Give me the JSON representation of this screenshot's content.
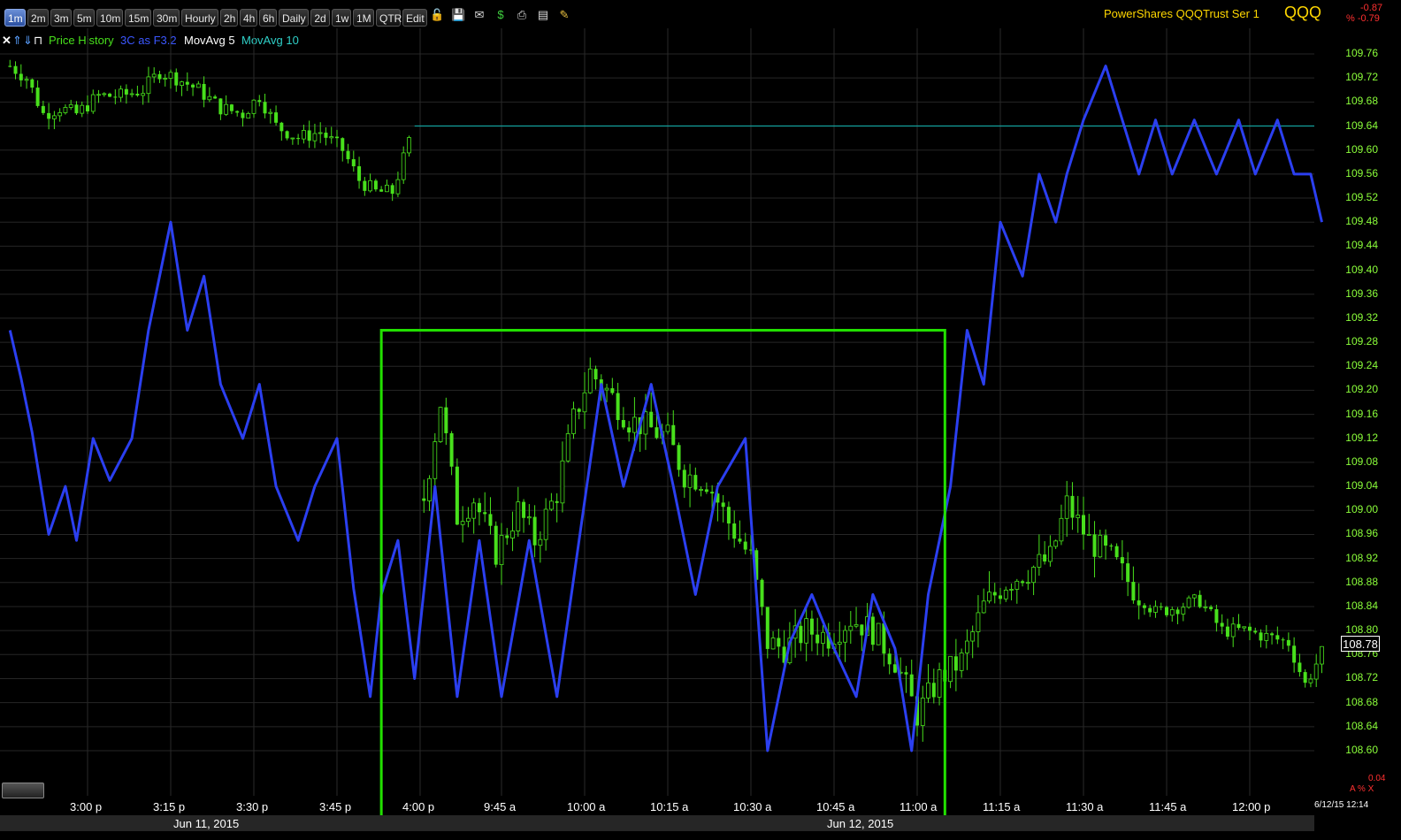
{
  "toolbar": {
    "timeframes": [
      "1m",
      "2m",
      "3m",
      "5m",
      "10m",
      "15m",
      "30m",
      "Hourly",
      "2h",
      "4h",
      "6h",
      "Daily",
      "2d",
      "1w",
      "1M",
      "QTR",
      "Edit"
    ],
    "active": "1m",
    "icons": [
      "lock-icon",
      "save-icon",
      "mail-icon",
      "dollar-icon",
      "print-icon",
      "card-icon",
      "pencil-icon"
    ]
  },
  "symbol": {
    "name": "PowerShares QQQTrust Ser 1",
    "ticker": "QQQ",
    "change": "-0.87",
    "change_pct": "% -0.79"
  },
  "legend": {
    "price_history": "Price History",
    "indicator": "3C as F3.2",
    "ma5": "MovAvg 5",
    "ma10": "MovAvg 10"
  },
  "colors": {
    "price": "#48e01c",
    "indicator": "#2b3ff0",
    "highlight_box": "#22e000",
    "ma10": "#14a09c",
    "axis_text": "#8bff3a"
  },
  "current_price": "108.78",
  "timestamp": "6/12/15 12:14",
  "bottom_right": {
    "value": "0.04",
    "label": "A % X"
  },
  "dates": [
    "Jun 11, 2015",
    "Jun 12, 2015"
  ],
  "chart_data": {
    "type": "candlestick",
    "title": "",
    "y_axis_ticks": [
      "109.76",
      "109.72",
      "109.68",
      "109.64",
      "109.60",
      "109.56",
      "109.52",
      "109.48",
      "109.44",
      "109.40",
      "109.36",
      "109.32",
      "109.28",
      "109.24",
      "109.20",
      "109.16",
      "109.12",
      "109.08",
      "109.04",
      "109.00",
      "108.96",
      "108.92",
      "108.88",
      "108.84",
      "108.80",
      "108.76",
      "108.72",
      "108.68",
      "108.64",
      "108.60"
    ],
    "ylim": [
      108.57,
      109.79
    ],
    "x_tick_labels": [
      "3:00 p",
      "3:15 p",
      "3:30 p",
      "3:45 p",
      "4:00 p",
      "9:45 a",
      "10:00 a",
      "10:15 a",
      "10:30 a",
      "10:45 a",
      "11:00 a",
      "11:15 a",
      "11:30 a",
      "11:45 a",
      "12:00 p"
    ],
    "sessions": [
      {
        "date": "Jun 11, 2015",
        "start": "2:46 p",
        "end": "4:00 p"
      },
      {
        "date": "Jun 12, 2015",
        "start": "9:30 a",
        "end": "12:14 p"
      }
    ],
    "price_path": [
      {
        "time": "2:46 p",
        "price": 109.74
      },
      {
        "time": "2:49 p",
        "price": 109.72
      },
      {
        "time": "2:52 p",
        "price": 109.66
      },
      {
        "time": "2:55 p",
        "price": 109.67
      },
      {
        "time": "2:58 p",
        "price": 109.66
      },
      {
        "time": "3:02 p",
        "price": 109.69
      },
      {
        "time": "3:06 p",
        "price": 109.69
      },
      {
        "time": "3:10 p",
        "price": 109.7
      },
      {
        "time": "3:13 p",
        "price": 109.73
      },
      {
        "time": "3:16 p",
        "price": 109.72
      },
      {
        "time": "3:20 p",
        "price": 109.7
      },
      {
        "time": "3:24 p",
        "price": 109.67
      },
      {
        "time": "3:28 p",
        "price": 109.66
      },
      {
        "time": "3:31 p",
        "price": 109.69
      },
      {
        "time": "3:34 p",
        "price": 109.64
      },
      {
        "time": "3:38 p",
        "price": 109.62
      },
      {
        "time": "3:42 p",
        "price": 109.63
      },
      {
        "time": "3:46 p",
        "price": 109.6
      },
      {
        "time": "3:49 p",
        "price": 109.55
      },
      {
        "time": "3:52 p",
        "price": 109.53
      },
      {
        "time": "3:55 p",
        "price": 109.53
      },
      {
        "time": "3:59 p",
        "price": 109.64
      },
      {
        "time": "9:31 a",
        "price": 109.02
      },
      {
        "time": "9:34 a",
        "price": 109.18
      },
      {
        "time": "9:37 a",
        "price": 108.99
      },
      {
        "time": "9:40 a",
        "price": 109.02
      },
      {
        "time": "9:44 a",
        "price": 108.93
      },
      {
        "time": "9:48 a",
        "price": 109.0
      },
      {
        "time": "9:51 a",
        "price": 108.95
      },
      {
        "time": "9:55 a",
        "price": 109.03
      },
      {
        "time": "9:58 a",
        "price": 109.15
      },
      {
        "time": "10:01 a",
        "price": 109.23
      },
      {
        "time": "10:04 a",
        "price": 109.2
      },
      {
        "time": "10:08 a",
        "price": 109.15
      },
      {
        "time": "10:11 a",
        "price": 109.14
      },
      {
        "time": "10:15 a",
        "price": 109.12
      },
      {
        "time": "10:18 a",
        "price": 109.06
      },
      {
        "time": "10:22 a",
        "price": 109.05
      },
      {
        "time": "10:26 a",
        "price": 108.98
      },
      {
        "time": "10:30 a",
        "price": 108.92
      },
      {
        "time": "10:33 a",
        "price": 108.78
      },
      {
        "time": "10:36 a",
        "price": 108.77
      },
      {
        "time": "10:40 a",
        "price": 108.8
      },
      {
        "time": "10:44 a",
        "price": 108.79
      },
      {
        "time": "10:48 a",
        "price": 108.82
      },
      {
        "time": "10:52 a",
        "price": 108.8
      },
      {
        "time": "10:56 a",
        "price": 108.75
      },
      {
        "time": "11:00 a",
        "price": 108.66
      },
      {
        "time": "11:04 a",
        "price": 108.72
      },
      {
        "time": "11:08 a",
        "price": 108.75
      },
      {
        "time": "11:12 a",
        "price": 108.84
      },
      {
        "time": "11:16 a",
        "price": 108.88
      },
      {
        "time": "11:20 a",
        "price": 108.9
      },
      {
        "time": "11:24 a",
        "price": 108.92
      },
      {
        "time": "11:27 a",
        "price": 109.01
      },
      {
        "time": "11:31 a",
        "price": 108.95
      },
      {
        "time": "11:35 a",
        "price": 108.92
      },
      {
        "time": "11:39 a",
        "price": 108.87
      },
      {
        "time": "11:43 a",
        "price": 108.83
      },
      {
        "time": "11:47 a",
        "price": 108.84
      },
      {
        "time": "11:51 a",
        "price": 108.85
      },
      {
        "time": "11:55 a",
        "price": 108.8
      },
      {
        "time": "11:59 a",
        "price": 108.8
      },
      {
        "time": "12:03 p",
        "price": 108.79
      },
      {
        "time": "12:07 p",
        "price": 108.78
      },
      {
        "time": "12:10 p",
        "price": 108.71
      },
      {
        "time": "12:14 p",
        "price": 108.78
      }
    ],
    "ma10_level": 109.64,
    "indicator_path": [
      {
        "time": "2:46 p",
        "price": 109.3
      },
      {
        "time": "2:48 p",
        "price": 109.22
      },
      {
        "time": "2:50 p",
        "price": 109.13
      },
      {
        "time": "2:53 p",
        "price": 108.96
      },
      {
        "time": "2:56 p",
        "price": 109.04
      },
      {
        "time": "2:58 p",
        "price": 108.95
      },
      {
        "time": "3:01 p",
        "price": 109.12
      },
      {
        "time": "3:04 p",
        "price": 109.05
      },
      {
        "time": "3:08 p",
        "price": 109.12
      },
      {
        "time": "3:11 p",
        "price": 109.3
      },
      {
        "time": "3:15 p",
        "price": 109.48
      },
      {
        "time": "3:18 p",
        "price": 109.3
      },
      {
        "time": "3:21 p",
        "price": 109.39
      },
      {
        "time": "3:24 p",
        "price": 109.21
      },
      {
        "time": "3:28 p",
        "price": 109.12
      },
      {
        "time": "3:31 p",
        "price": 109.21
      },
      {
        "time": "3:34 p",
        "price": 109.04
      },
      {
        "time": "3:38 p",
        "price": 108.95
      },
      {
        "time": "3:41 p",
        "price": 109.04
      },
      {
        "time": "3:45 p",
        "price": 109.12
      },
      {
        "time": "3:48 p",
        "price": 108.87
      },
      {
        "time": "3:51 p",
        "price": 108.69
      },
      {
        "time": "3:53 p",
        "price": 108.86
      },
      {
        "time": "3:56 p",
        "price": 108.95
      },
      {
        "time": "3:59 p",
        "price": 108.72
      },
      {
        "time": "9:33 a",
        "price": 109.04
      },
      {
        "time": "9:37 a",
        "price": 108.69
      },
      {
        "time": "9:41 a",
        "price": 108.95
      },
      {
        "time": "9:45 a",
        "price": 108.69
      },
      {
        "time": "9:50 a",
        "price": 108.95
      },
      {
        "time": "9:55 a",
        "price": 108.69
      },
      {
        "time": "9:59 a",
        "price": 108.95
      },
      {
        "time": "10:03 a",
        "price": 109.21
      },
      {
        "time": "10:07 a",
        "price": 109.04
      },
      {
        "time": "10:12 a",
        "price": 109.21
      },
      {
        "time": "10:16 a",
        "price": 109.04
      },
      {
        "time": "10:20 a",
        "price": 108.86
      },
      {
        "time": "10:24 a",
        "price": 109.04
      },
      {
        "time": "10:29 a",
        "price": 109.12
      },
      {
        "time": "10:33 a",
        "price": 108.6
      },
      {
        "time": "10:37 a",
        "price": 108.78
      },
      {
        "time": "10:41 a",
        "price": 108.86
      },
      {
        "time": "10:45 a",
        "price": 108.77
      },
      {
        "time": "10:49 a",
        "price": 108.69
      },
      {
        "time": "10:52 a",
        "price": 108.86
      },
      {
        "time": "10:56 a",
        "price": 108.77
      },
      {
        "time": "10:59 a",
        "price": 108.6
      },
      {
        "time": "11:02 a",
        "price": 108.86
      },
      {
        "time": "11:04 a",
        "price": 108.95
      },
      {
        "time": "11:06 a",
        "price": 109.04
      },
      {
        "time": "11:09 a",
        "price": 109.3
      },
      {
        "time": "11:12 a",
        "price": 109.21
      },
      {
        "time": "11:15 a",
        "price": 109.48
      },
      {
        "time": "11:19 a",
        "price": 109.39
      },
      {
        "time": "11:22 a",
        "price": 109.56
      },
      {
        "time": "11:25 a",
        "price": 109.48
      },
      {
        "time": "11:27 a",
        "price": 109.56
      },
      {
        "time": "11:30 a",
        "price": 109.65
      },
      {
        "time": "11:34 a",
        "price": 109.74
      },
      {
        "time": "11:37 a",
        "price": 109.65
      },
      {
        "time": "11:40 a",
        "price": 109.56
      },
      {
        "time": "11:43 a",
        "price": 109.65
      },
      {
        "time": "11:46 a",
        "price": 109.56
      },
      {
        "time": "11:50 a",
        "price": 109.65
      },
      {
        "time": "11:54 a",
        "price": 109.56
      },
      {
        "time": "11:58 a",
        "price": 109.65
      },
      {
        "time": "12:01 p",
        "price": 109.56
      },
      {
        "time": "12:05 p",
        "price": 109.65
      },
      {
        "time": "12:08 p",
        "price": 109.56
      },
      {
        "time": "12:11 p",
        "price": 109.56
      },
      {
        "time": "12:13 p",
        "price": 109.48
      }
    ],
    "highlight_box": {
      "from": "3:53 p",
      "to": "11:05 a",
      "price_top": 109.3,
      "price_bottom": 108.57
    },
    "grid": true
  }
}
